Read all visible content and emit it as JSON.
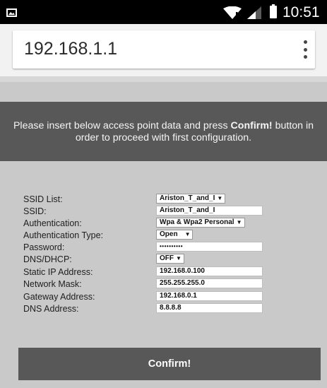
{
  "status_bar": {
    "time": "10:51",
    "icons": [
      "image-icon",
      "wifi-alert-icon",
      "cell-signal-icon",
      "battery-icon"
    ]
  },
  "browser": {
    "url": "192.168.1.1",
    "menu_icon": "more-vert-icon"
  },
  "banner": {
    "text_before": "Please insert below access point data and press ",
    "text_bold": "Confirm!",
    "text_after": " button in order to proceed with first configuration."
  },
  "form": {
    "ssid_list": {
      "label": "SSID List:",
      "value": "Ariston_T_and_I"
    },
    "ssid": {
      "label": "SSID:",
      "value": "Ariston_T_and_I"
    },
    "authentication": {
      "label": "Authentication:",
      "value": "Wpa & Wpa2 Personal"
    },
    "authentication_type": {
      "label": "Authentication Type:",
      "value": "Open"
    },
    "password": {
      "label": "Password:",
      "value": "••••••••••"
    },
    "dns_dhcp": {
      "label": "DNS/DHCP:",
      "value": "OFF"
    },
    "static_ip": {
      "label": "Static IP Address:",
      "value": "192.168.0.100"
    },
    "network_mask": {
      "label": "Network Mask:",
      "value": "255.255.255.0"
    },
    "gateway": {
      "label": "Gateway Address:",
      "value": "192.168.0.1"
    },
    "dns_address": {
      "label": "DNS Address:",
      "value": "8.8.8.8"
    }
  },
  "confirm_label": "Confirm!",
  "colors": {
    "banner_bg": "#585858",
    "page_bg": "#c9c9c9",
    "status_bg": "#000000"
  }
}
